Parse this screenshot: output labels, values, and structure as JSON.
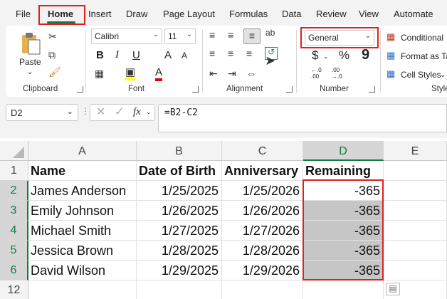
{
  "menu": {
    "tabs": [
      "File",
      "Home",
      "Insert",
      "Draw",
      "Page Layout",
      "Formulas",
      "Data",
      "Review",
      "View",
      "Automate"
    ]
  },
  "ribbon": {
    "clipboard": {
      "paste_label": "Paste",
      "group_label": "Clipboard"
    },
    "font": {
      "font_name": "Calibri",
      "font_size": "11",
      "group_label": "Font",
      "grow": "A",
      "shrink": "A",
      "bold": "B",
      "italic": "I",
      "underline": "U",
      "font_color": "A",
      "font_color_hex": "#e00000",
      "highlight_hex": "#ffff00"
    },
    "alignment": {
      "group_label": "Alignment",
      "wrap_icon": "ab"
    },
    "number": {
      "format": "General",
      "group_label": "Number",
      "currency": "$",
      "percent": "%",
      "comma": "9",
      "inc_dec": "←.0\n.00",
      "dec_dec": ".00\n→.0"
    },
    "styles": {
      "conditional": "Conditional",
      "format_as_table": "Format as Ta",
      "cell_styles": "Cell Styles",
      "group_label": "Style"
    }
  },
  "formula_bar": {
    "name_box": "D2",
    "fx": "fx",
    "formula": "=B2-C2"
  },
  "columns": [
    "A",
    "B",
    "C",
    "D",
    "E"
  ],
  "rows": [
    "1",
    "2",
    "3",
    "4",
    "5",
    "6",
    "12"
  ],
  "sheet": {
    "headers": [
      "Name",
      "Date of Birth",
      "Anniversary",
      "Remaining"
    ],
    "data": [
      [
        "James Anderson",
        "1/25/2025",
        "1/25/2026",
        "-365"
      ],
      [
        "Emily Johnson",
        "1/26/2025",
        "1/26/2026",
        "-365"
      ],
      [
        "Michael Smith",
        "1/27/2025",
        "1/27/2026",
        "-365"
      ],
      [
        "Jessica Brown",
        "1/28/2025",
        "1/28/2026",
        "-365"
      ],
      [
        "David Wilson",
        "1/29/2025",
        "1/29/2026",
        "-365"
      ]
    ]
  },
  "colors": {
    "accent": "#107c41",
    "highlight_box": "#e0201e"
  }
}
